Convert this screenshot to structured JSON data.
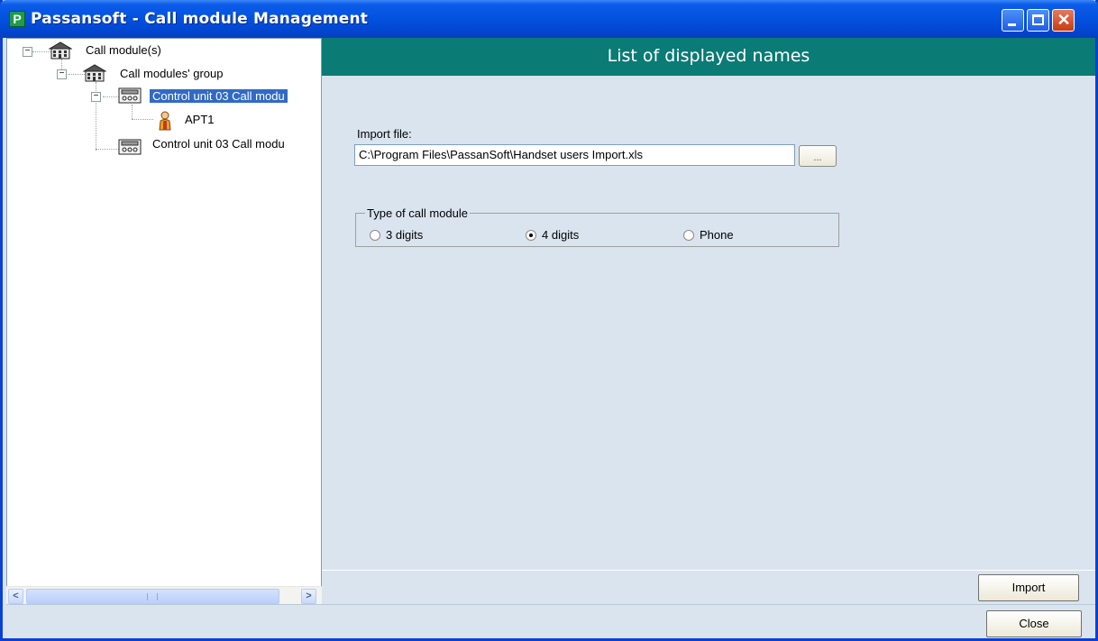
{
  "window": {
    "app_icon_letter": "P",
    "title": "Passansoft - Call module Management",
    "colors": {
      "titlebar": "#0351df",
      "header": "#0a7b75",
      "selection": "#316ac5",
      "background": "#d9e4ee"
    }
  },
  "tree": {
    "items": [
      {
        "label": "Call module(s)",
        "icon": "building-icon",
        "expander": "−"
      },
      {
        "label": "Call modules' group",
        "icon": "building-icon",
        "expander": "−"
      },
      {
        "label": "Control unit 03 Call modu",
        "icon": "control-unit-icon",
        "expander": "−",
        "selected": true
      },
      {
        "label": "APT1",
        "icon": "person-icon"
      },
      {
        "label": "Control unit 03 Call modu",
        "icon": "control-unit-icon"
      }
    ]
  },
  "scrollbar": {
    "left_arrow": "<",
    "right_arrow": ">"
  },
  "main": {
    "header": "List of displayed names",
    "import_file_label": "Import file:",
    "import_file_value": "C:\\Program Files\\PassanSoft\\Handset users Import.xls",
    "browse_label": "...",
    "call_module_type": {
      "legend": "Type of call module",
      "options": [
        "3 digits",
        "4 digits",
        "Phone"
      ],
      "selected": "4 digits"
    },
    "import_button": "Import",
    "close_button": "Close"
  }
}
